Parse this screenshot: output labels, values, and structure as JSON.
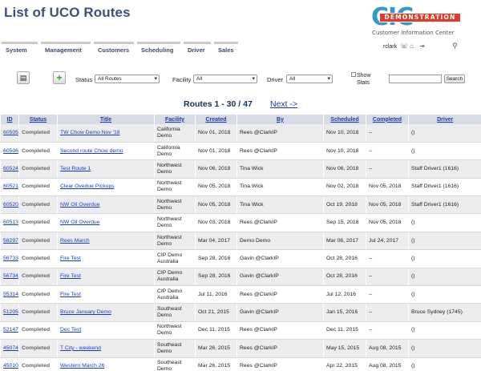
{
  "page": {
    "title": "List of UCO Routes"
  },
  "logo": {
    "mark": "CIC",
    "badge": "DEMONSTRATION",
    "subtitle": "Customer Information Center"
  },
  "nav": {
    "items": [
      "System",
      "Management",
      "Customers",
      "Scheduling",
      "Driver",
      "Sales"
    ]
  },
  "user": {
    "name": "rclark",
    "icons": [
      "phone-icon",
      "home-icon",
      "logout-icon"
    ],
    "search_icon": "search-icon"
  },
  "toolbar": {
    "status_label": "Status",
    "status_value": "All Routes",
    "facility_label": "Facility",
    "facility_value": "All",
    "driver_label": "Driver",
    "driver_value": "All",
    "show_stats_label": "Show Stats",
    "search_placeholder": "",
    "search_button": "Search"
  },
  "pagination": {
    "label": "Routes 1 - 30 / 47",
    "next": "Next ->"
  },
  "table": {
    "columns": [
      "ID",
      "Status",
      "Title",
      "Facility",
      "Created",
      "By",
      "Scheduled",
      "Completed",
      "Driver"
    ],
    "rows": [
      {
        "id": "60505",
        "status": "Completed",
        "title": "TW Chow Demo Nov '18",
        "facility": "California Demo",
        "created": "Nov 01, 2018",
        "by": "Rees @ClarkIP",
        "scheduled": "Nov 10, 2018",
        "completed": "--",
        "driver": "()"
      },
      {
        "id": "60506",
        "status": "Completed",
        "title": "Second route Chow demo",
        "facility": "California Demo",
        "created": "Nov 01, 2018",
        "by": "Rees @ClarkIP",
        "scheduled": "Nov 10, 2018",
        "completed": "--",
        "driver": "()"
      },
      {
        "id": "60524",
        "status": "Completed",
        "title": "Test Route 1",
        "facility": "Northwest Demo",
        "created": "Nov 06, 2018",
        "by": "Tina Wick",
        "scheduled": "Nov 06, 2018",
        "completed": "--",
        "driver": "Staff Driver1 (1616)"
      },
      {
        "id": "60521",
        "status": "Completed",
        "title": "Clear Ovedue Pickups",
        "facility": "Northwest Demo",
        "created": "Nov 05, 2018",
        "by": "Tina Wick",
        "scheduled": "Nov 02, 2018",
        "completed": "Nov 05, 2018",
        "driver": "Staff Driver1 (1616)"
      },
      {
        "id": "60520",
        "status": "Completed",
        "title": "NW Oil Overdue",
        "facility": "Northwest Demo",
        "created": "Nov 05, 2018",
        "by": "Tina Wick",
        "scheduled": "Oct 19, 2018",
        "completed": "Nov 05, 2018",
        "driver": "Staff Driver1 (1616)"
      },
      {
        "id": "60513",
        "status": "Completed",
        "title": "NW Oil Overdue",
        "facility": "Northwest Demo",
        "created": "Nov 03, 2018",
        "by": "Rees @ClarkIP",
        "scheduled": "Sep 15, 2018",
        "completed": "Nov 05, 2018",
        "driver": "()"
      },
      {
        "id": "58297",
        "status": "Completed",
        "title": "Rees March",
        "facility": "Northwest Demo",
        "created": "Mar 04, 2017",
        "by": "Demo Demo",
        "scheduled": "Mar 06, 2017",
        "completed": "Jul 24, 2017",
        "driver": "()"
      },
      {
        "id": "56733",
        "status": "Completed",
        "title": "Fire Test",
        "facility": "CIP Demo Australia",
        "created": "Sep 28, 2016",
        "by": "Gavin @ClarkIP",
        "scheduled": "Oct 28, 2016",
        "completed": "--",
        "driver": "()"
      },
      {
        "id": "56734",
        "status": "Completed",
        "title": "Fire Test",
        "facility": "CIP Demo Australia",
        "created": "Sep 28, 2016",
        "by": "Gavin @ClarkIP",
        "scheduled": "Oct 28, 2016",
        "completed": "--",
        "driver": "()"
      },
      {
        "id": "55314",
        "status": "Completed",
        "title": "Fire Test",
        "facility": "CIP Demo Australia",
        "created": "Jul 11, 2016",
        "by": "Rees @ClarkIP",
        "scheduled": "Jul 12, 2016",
        "completed": "--",
        "driver": "()"
      },
      {
        "id": "51205",
        "status": "Completed",
        "title": "Bruce January Demo",
        "facility": "Southeast Demo",
        "created": "Oct 21, 2015",
        "by": "Gavin @ClarkIP",
        "scheduled": "Jan 15, 2016",
        "completed": "--",
        "driver": "Bruce Sydney (1745)"
      },
      {
        "id": "52147",
        "status": "Completed",
        "title": "Dec Test",
        "facility": "Northwest Demo",
        "created": "Dec 11, 2015",
        "by": "Rees @ClarkIP",
        "scheduled": "Dec 11, 2015",
        "completed": "--",
        "driver": "()"
      },
      {
        "id": "45074",
        "status": "Completed",
        "title": "T City - weekend",
        "facility": "Southeast Demo",
        "created": "Mar 26, 2015",
        "by": "Rees @ClarkIP",
        "scheduled": "May 15, 2015",
        "completed": "Aug 08, 2015",
        "driver": "()"
      },
      {
        "id": "45010",
        "status": "Completed",
        "title": "Western March 26",
        "facility": "Southeast Demo",
        "created": "Mar 26, 2015",
        "by": "Rees @ClarkIP",
        "scheduled": "Apr 22, 2015",
        "completed": "Aug 08, 2015",
        "driver": "()"
      }
    ]
  }
}
